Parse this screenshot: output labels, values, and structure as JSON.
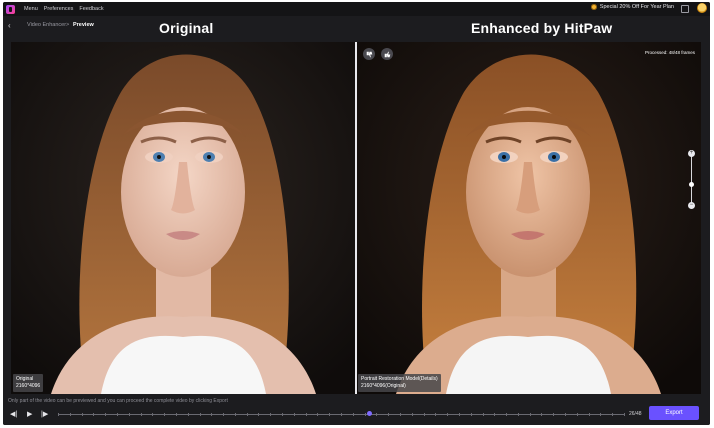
{
  "menubar": {
    "items": [
      "Menu",
      "Preferences",
      "Feedback"
    ],
    "promo": "Special 20% Off For Year Plan"
  },
  "breadcrumb": {
    "parent": "Video Enhancer",
    "separator": ">",
    "current": "Preview"
  },
  "compare": {
    "left_title": "Original",
    "right_title": "Enhanced by HitPaw",
    "processed": "Processed: 48/48 frames"
  },
  "left_badge": {
    "name": "Original",
    "resolution": "2160*4096"
  },
  "right_badge": {
    "model": "Portrait Restoration Model(Details)",
    "resolution": "2160*4096(Original)"
  },
  "zoom": {
    "plus": "+",
    "minus": "−"
  },
  "playback": {
    "notice": "Only part of the video can be previewed and you can proceed the complete video by clicking Export",
    "frame_count": "26/48",
    "progress": 0.55,
    "export_label": "Export"
  },
  "colors": {
    "accent": "#6a51ff",
    "background": "#1c1c1f"
  },
  "icons": {
    "back": "chevron-left-icon",
    "thumbs_down": "thumbs-down-icon",
    "thumbs_up": "thumbs-up-icon",
    "prev_frame": "step-back-icon",
    "play": "play-icon",
    "next_frame": "step-forward-icon"
  }
}
